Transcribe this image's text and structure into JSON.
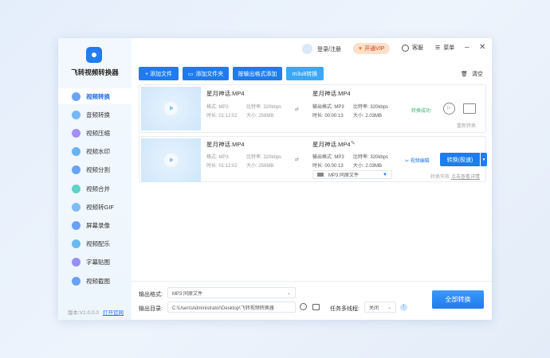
{
  "app": {
    "name": "飞转视频转换器",
    "version": "版本:V1.0.0.0",
    "website": "打开官网"
  },
  "header": {
    "login": "登录/注册",
    "vip": "开通VIP",
    "service": "客服",
    "menu": "菜单"
  },
  "sidebar": {
    "items": [
      {
        "label": "视频转换",
        "color": "#3a86f0"
      },
      {
        "label": "音频转换",
        "color": "#4aa3f5"
      },
      {
        "label": "视频压缩",
        "color": "#8a6cf0"
      },
      {
        "label": "视频水印",
        "color": "#3a9cf0"
      },
      {
        "label": "视频分割",
        "color": "#3a86f0"
      },
      {
        "label": "视频合并",
        "color": "#2ec4b6"
      },
      {
        "label": "视频转GIF",
        "color": "#5aa8f0"
      },
      {
        "label": "屏幕录像",
        "color": "#3a86f0"
      },
      {
        "label": "视频配乐",
        "color": "#3aa4f0"
      },
      {
        "label": "字幕贴图",
        "color": "#7a6cf0"
      },
      {
        "label": "视频截图",
        "color": "#3a86f0"
      }
    ]
  },
  "toolbar": {
    "add_file": "+ 添加文件",
    "add_folder": "添加文件夹",
    "add_by_format": "按输出格式添加",
    "m3u8": "m3u8转换",
    "clear": "清空"
  },
  "files": [
    {
      "name": "星月神话.MP4",
      "format": "格式: MP3",
      "bitrate": "比特率: 320kbps",
      "duration": "时长: 01:12:02",
      "size": "大小: 256MB",
      "out_name": "星月神话.MP4",
      "out_format": "输出格式: MP3",
      "out_bitrate": "比特率: 320kbps",
      "out_duration": "时长: 00:00:13",
      "out_size": "大小: 2.03MB",
      "status": "转换成功",
      "reconvert": "重新转换"
    },
    {
      "name": "星月神话.MP4",
      "format": "格式: MP3",
      "bitrate": "比特率: 320kbps",
      "duration": "时长: 01:12:02",
      "size": "大小: 256MB",
      "out_name": "星月神话.MP4",
      "out_format": "输出格式: MP3",
      "out_bitrate": "比特率: 320kbps",
      "out_duration": "时长: 00:00:13",
      "out_size": "大小: 2.03MB",
      "format_select": "MP3 同原文件",
      "edit": "视频编辑",
      "convert": "转换(极速)",
      "fail": "转换失败",
      "detail": "点击查看详情"
    }
  ],
  "bottom": {
    "format_label": "输出格式:",
    "format_value": "MP3  同原文件",
    "dir_label": "输出目录:",
    "dir_value": "C:\\Users\\Administrator\\Desktop\\飞转视频转换器",
    "thread_label": "任务多线程:",
    "thread_value": "关闭",
    "convert_all": "全部转换"
  }
}
